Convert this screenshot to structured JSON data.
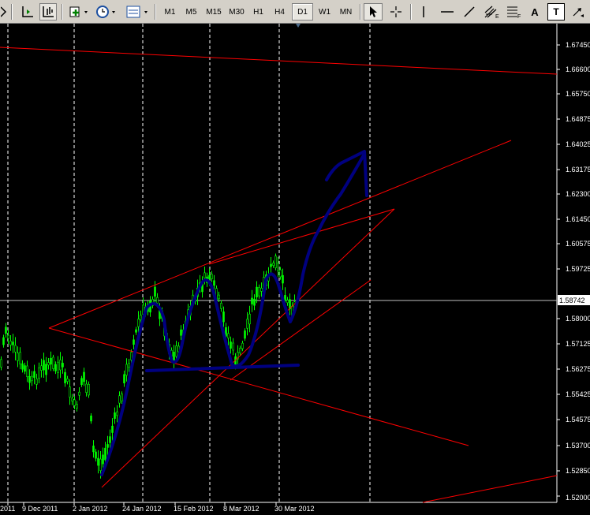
{
  "toolbar": {
    "timeframes": [
      "M1",
      "M5",
      "M15",
      "M30",
      "H1",
      "H4",
      "D1",
      "W1",
      "MN"
    ],
    "active_timeframe": "D1",
    "text_tool_label": "A",
    "label_tool_label": "T"
  },
  "chart": {
    "price_ticks": [
      "1.67450",
      "1.66600",
      "1.65750",
      "1.64875",
      "1.64025",
      "1.63175",
      "1.62300",
      "1.61450",
      "1.60575",
      "1.59725",
      "1.58000",
      "1.57125",
      "1.56275",
      "1.55425",
      "1.54575",
      "1.53700",
      "1.52850",
      "1.52000"
    ],
    "current_price": "1.58742",
    "date_ticks": [
      "2011",
      "9 Dec 2011",
      "2 Jan 2012",
      "24 Jan 2012",
      "15 Feb 2012",
      "8 Mar 2012",
      "30 Mar 2012"
    ],
    "colors": {
      "background": "#000000",
      "candle": "#00ff00",
      "lines": "#ff0000",
      "drawing": "#000080",
      "grid": "#ffffff"
    }
  }
}
